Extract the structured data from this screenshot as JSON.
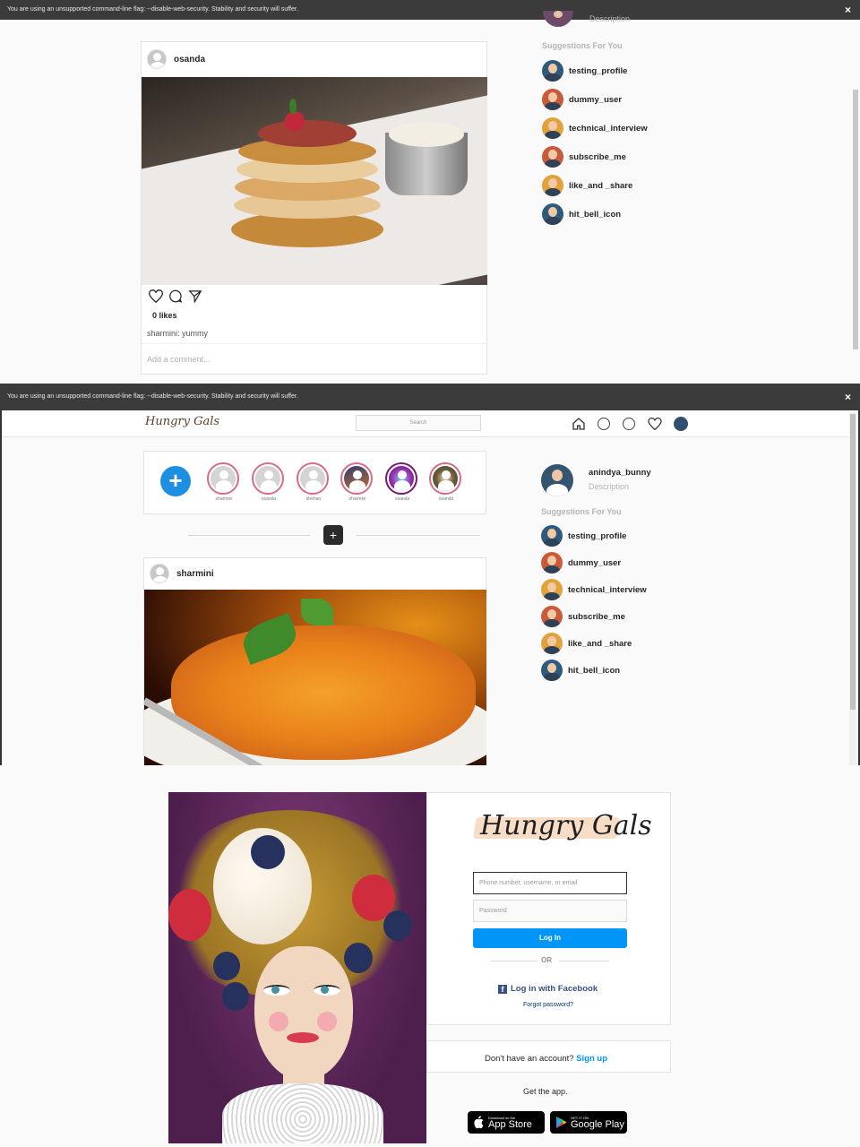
{
  "top_screenshot": {
    "infobar_text": "You are using an unsupported command-line flag: --disable-web-security. Stability and security will suffer.",
    "close_symbol": "×",
    "profile_desc": "Description",
    "post": {
      "username": "osanda",
      "likes": "0 likes",
      "caption": "sharmini: yummy",
      "comment_placeholder": "Add a comment..."
    },
    "suggestions_title": "Suggestions For You",
    "suggestions": [
      "testing_profile",
      "dummy_user",
      "technical_interview",
      "subscribe_me",
      "like_and _share",
      "hit_bell_icon"
    ]
  },
  "middle_screenshot": {
    "infobar_text": "You are using an unsupported command-line flag: --disable-web-security. Stability and security will suffer.",
    "close_symbol": "×",
    "logo": "Hungry Gals",
    "search_placeholder": "Search",
    "stories": [
      "sharmini",
      "osanda",
      "shehan",
      "sharmini",
      "osanda",
      "osanda"
    ],
    "add_symbol": "+",
    "post_username": "sharmini",
    "profile": {
      "username": "anindya_bunny",
      "desc": "Description"
    },
    "suggestions_title": "Suggestions For You",
    "suggestions": [
      "testing_profile",
      "dummy_user",
      "technical_interview",
      "subscribe_me",
      "like_and _share",
      "hit_bell_icon"
    ]
  },
  "login": {
    "logo": "Hungry Gals",
    "username_placeholder": "Phone number, username, or email",
    "password_placeholder": "Password",
    "login_button": "Log In",
    "or": "OR",
    "facebook_login": "Log in with Facebook",
    "forgot_password": "Forgot password?",
    "no_account": "Don't have an account?",
    "signup": "Sign up",
    "get_app": "Get the app.",
    "app_store_small": "Download on the",
    "app_store": "App Store",
    "google_play_small": "GET IT ON",
    "google_play": "Google Play"
  },
  "colors": {
    "accent": "#0095f6",
    "facebook": "#385185",
    "story_ring": "#d86b85"
  }
}
